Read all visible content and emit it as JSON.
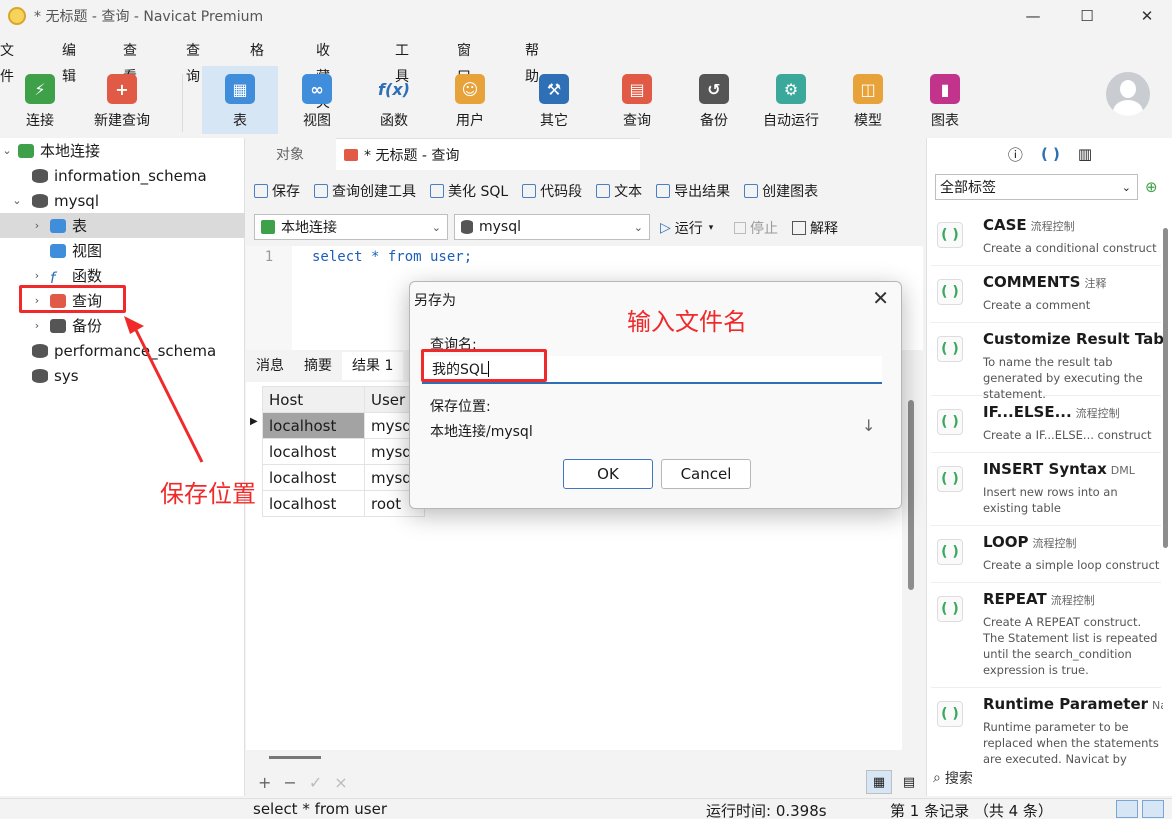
{
  "window": {
    "title": "* 无标题 - 查询 - Navicat Premium",
    "controls": {
      "minimize": "—",
      "maximize": "☐",
      "close": "✕"
    }
  },
  "menu": [
    "文件",
    "编辑",
    "查看",
    "查询",
    "格式",
    "收藏夹",
    "工具",
    "窗口",
    "帮助"
  ],
  "toolbar": [
    {
      "label": "连接",
      "icon": "connect-icon",
      "color": "#3fa04a"
    },
    {
      "label": "新建查询",
      "icon": "new-query-icon",
      "color": "#e15a46"
    },
    {
      "label": "表",
      "icon": "table-icon",
      "color": "#3f8ddb",
      "active": true
    },
    {
      "label": "视图",
      "icon": "view-icon",
      "color": "#3f8ddb"
    },
    {
      "label": "函数",
      "icon": "function-icon",
      "color": "#3f8ddb"
    },
    {
      "label": "用户",
      "icon": "user-icon",
      "color": "#e8a23a"
    },
    {
      "label": "其它",
      "icon": "other-icon",
      "color": "#2f6fb5"
    },
    {
      "label": "查询",
      "icon": "query-icon",
      "color": "#e15a46"
    },
    {
      "label": "备份",
      "icon": "backup-icon",
      "color": "#555555"
    },
    {
      "label": "自动运行",
      "icon": "robot-icon",
      "color": "#3aa89a"
    },
    {
      "label": "模型",
      "icon": "model-icon",
      "color": "#e8a23a"
    },
    {
      "label": "图表",
      "icon": "chart-icon",
      "color": "#c2338c"
    }
  ],
  "tree": [
    {
      "label": "本地连接",
      "level": 0,
      "expanded": true,
      "icon": "connection-icon"
    },
    {
      "label": "information_schema",
      "level": 1,
      "icon": "database-icon"
    },
    {
      "label": "mysql",
      "level": 1,
      "expanded": true,
      "icon": "database-icon"
    },
    {
      "label": "表",
      "level": 2,
      "selected": true,
      "icon": "table-icon"
    },
    {
      "label": "视图",
      "level": 2,
      "icon": "view-icon"
    },
    {
      "label": "函数",
      "level": 2,
      "icon": "function-icon"
    },
    {
      "label": "查询",
      "level": 2,
      "icon": "query-icon"
    },
    {
      "label": "备份",
      "level": 2,
      "icon": "backup-icon"
    },
    {
      "label": "performance_schema",
      "level": 1,
      "icon": "database-icon"
    },
    {
      "label": "sys",
      "level": 1,
      "icon": "database-icon"
    }
  ],
  "tabs": {
    "objects": "对象",
    "query_tab": "* 无标题 - 查询"
  },
  "query_toolbar": [
    "保存",
    "查询创建工具",
    "美化 SQL",
    "代码段",
    "文本",
    "导出结果",
    "创建图表"
  ],
  "selectors": {
    "connection": "本地连接",
    "database": "mysql",
    "run": "运行",
    "stop": "停止",
    "explain": "解释"
  },
  "editor": {
    "line_number": "1",
    "code": "select * from user;"
  },
  "result_tabs": [
    "消息",
    "摘要",
    "结果 1"
  ],
  "grid": {
    "columns": [
      "Host",
      "User"
    ],
    "rows": [
      [
        "localhost",
        "mysq"
      ],
      [
        "localhost",
        "mysq"
      ],
      [
        "localhost",
        "mysq"
      ],
      [
        "localhost",
        "root"
      ]
    ]
  },
  "grid_actions": [
    "+",
    "−",
    "✓",
    "×"
  ],
  "right_panel": {
    "filter": "全部标签",
    "snippets": [
      {
        "name": "CASE",
        "tag": "流程控制",
        "desc": "Create a conditional construct"
      },
      {
        "name": "COMMENTS",
        "tag": "注释",
        "desc": "Create a comment"
      },
      {
        "name": "Customize Result Tab N",
        "tag": "",
        "desc": "To name the result tab generated by executing the statement."
      },
      {
        "name": "IF...ELSE...",
        "tag": "流程控制",
        "desc": "Create a IF...ELSE... construct"
      },
      {
        "name": "INSERT Syntax",
        "tag": "DML",
        "desc": "Insert new rows into an existing table"
      },
      {
        "name": "LOOP",
        "tag": "流程控制",
        "desc": "Create a simple loop construct"
      },
      {
        "name": "REPEAT",
        "tag": "流程控制",
        "desc": "Create A REPEAT construct. The Statement list is repeated until the search_condition expression is true."
      },
      {
        "name": "Runtime Parameter",
        "tag": "Nav",
        "desc": "Runtime parameter to be replaced when the statements are executed. Navicat by then..."
      }
    ],
    "search": "搜索"
  },
  "status": {
    "sql": "select * from user",
    "runtime": "运行时间: 0.398s",
    "records": "第 1 条记录 （共 4 条）"
  },
  "dialog": {
    "title": "另存为",
    "name_label": "查询名:",
    "name_value": "我的SQL",
    "location_label": "保存位置:",
    "location_value": "本地连接/mysql",
    "ok": "OK",
    "cancel": "Cancel"
  },
  "annotations": {
    "input_hint": "输入文件名",
    "location_hint": "保存位置"
  }
}
